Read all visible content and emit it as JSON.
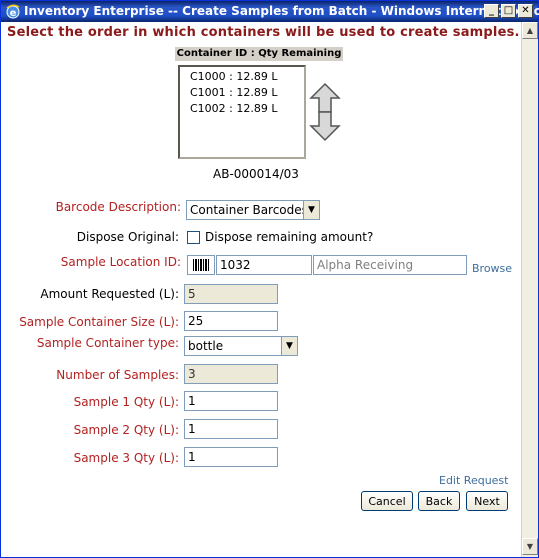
{
  "window": {
    "title": "Inventory Enterprise -- Create Samples from Batch - Windows Internet Explorer",
    "minimize_glyph": "_",
    "maximize_glyph": "□",
    "close_glyph": "✕"
  },
  "instructions": "Select the order in which containers will be used to create samples.",
  "container_list": {
    "header": "Container ID : Qty Remaining",
    "items": [
      "C1000 : 12.89 L",
      "C1001 : 12.89 L",
      "C1002 : 12.89 L"
    ]
  },
  "batch_id": "AB-000014/03",
  "form": {
    "barcode_description": {
      "label": "Barcode Description:",
      "value": "Container Barcodes"
    },
    "dispose_original": {
      "label": "Dispose Original:",
      "checkbox_label": "Dispose remaining amount?"
    },
    "sample_location": {
      "label": "Sample Location ID:",
      "id_value": "1032",
      "name_value": "Alpha Receiving",
      "browse": "Browse"
    },
    "amount_requested": {
      "label": "Amount Requested (L):",
      "value": "5"
    },
    "sample_container_size": {
      "label": "Sample Container Size (L):",
      "value": "25"
    },
    "sample_container_type": {
      "label": "Sample Container type:",
      "value": "bottle"
    },
    "number_of_samples": {
      "label": "Number of Samples:",
      "value": "3"
    },
    "sample1_qty": {
      "label": "Sample 1 Qty (L):",
      "value": "1"
    },
    "sample2_qty": {
      "label": "Sample 2 Qty (L):",
      "value": "1"
    },
    "sample3_qty": {
      "label": "Sample 3 Qty (L):",
      "value": "1"
    }
  },
  "edit_request": "Edit Request",
  "buttons": {
    "cancel": "Cancel",
    "back": "Back",
    "next": "Next"
  }
}
